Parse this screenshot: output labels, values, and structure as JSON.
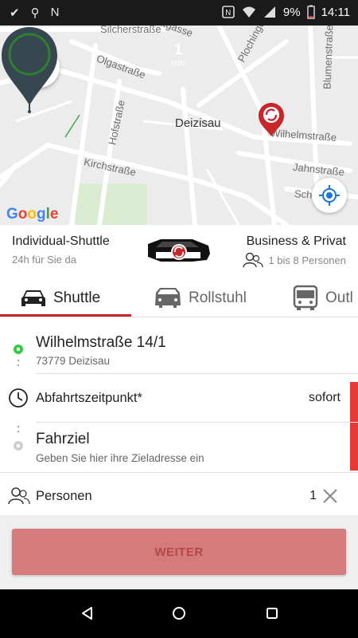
{
  "status_bar": {
    "battery": "9%",
    "time": "14:11",
    "icons": [
      "check-icon",
      "usb-icon",
      "n-icon",
      "nfc-icon",
      "wifi-icon",
      "signal-icon",
      "battery-icon"
    ]
  },
  "map": {
    "streets": [
      "Silcherstraße",
      "Zehntgasse",
      "Olgastraße",
      "Hofstraße",
      "Kirchstraße",
      "Wilhelmstraße",
      "Jahnstraße",
      "Blumenstraße",
      "Plochinger Str.",
      "Sch"
    ],
    "google_logo": "Google",
    "eta_pin": {
      "number": "1",
      "unit": "MIN",
      "color": "#2e7d32"
    },
    "pin_label": "Deizisau",
    "brand_color": "#c8262a"
  },
  "service": {
    "title": "Individual-Shuttle",
    "subtitle": "24h für Sie da",
    "right_title": "Business & Privat",
    "right_sub": "1 bis 8 Personen"
  },
  "tabs": [
    {
      "label": "Shuttle",
      "icon": "car-icon",
      "active": true
    },
    {
      "label": "Rollstuhl",
      "icon": "van-icon",
      "active": false
    },
    {
      "label": "Outl",
      "icon": "bus-icon",
      "active": false
    }
  ],
  "form": {
    "pickup": {
      "address": "Wilhelmstraße 14/1",
      "city": "73779 Deizisau"
    },
    "departure": {
      "label": "Abfahrtszeitpunkt*",
      "value": "sofort"
    },
    "destination": {
      "label": "Fahrziel",
      "placeholder": "Geben Sie hier ihre Zieladresse ein"
    },
    "persons": {
      "label": "Personen",
      "value": "1"
    }
  },
  "actions": {
    "continue_label": "WEITER"
  },
  "colors": {
    "accent": "#c8262a",
    "button": "#d57b7b",
    "pickup_dot": "#2ecc40"
  }
}
